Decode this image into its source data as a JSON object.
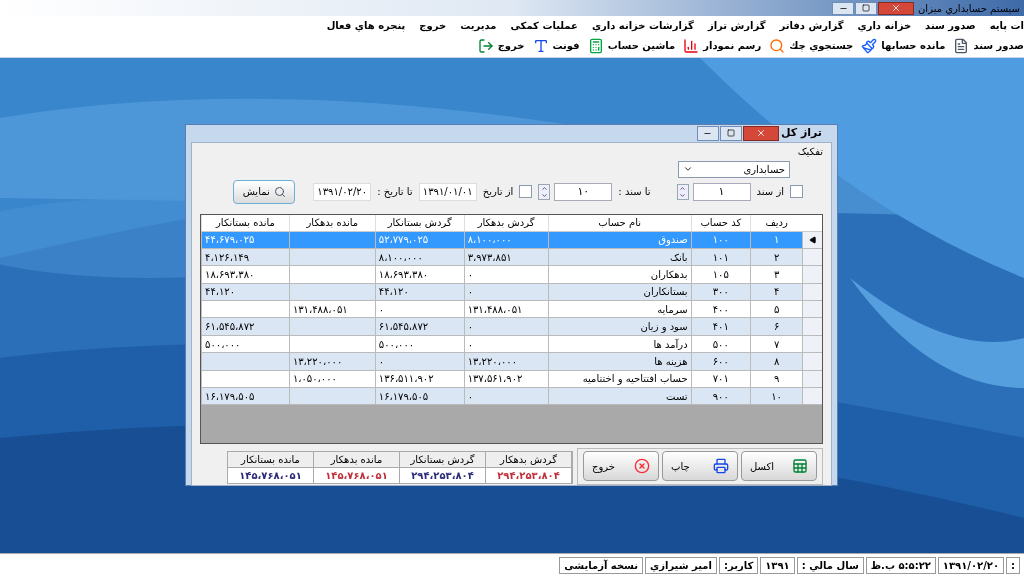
{
  "app_window": {
    "title": "سیستم حسابداري ميزان"
  },
  "menu": [
    "ات پایه",
    "صدور سند",
    "خزانه داري",
    "گزارش دفاتر",
    "گزارش تراز",
    "گزارشات خزانه داري",
    "عملیات کمکی",
    "مدیریت",
    "خروج",
    "پنجره هاي فعال"
  ],
  "toolbar": [
    {
      "label": "صدور سند",
      "kind": "document"
    },
    {
      "label": "مانده حسابها",
      "kind": "brush"
    },
    {
      "label": "جستجوي چك",
      "kind": "search"
    },
    {
      "label": "رسم نمودار",
      "kind": "chart"
    },
    {
      "label": "ماشین حساب",
      "kind": "calculator"
    },
    {
      "label": "فونت",
      "kind": "font"
    },
    {
      "label": "خروج",
      "kind": "exit"
    }
  ],
  "dialog": {
    "title": "تراز کل",
    "group_label": "تفکیک",
    "category": "حسابداری",
    "from_doc": {
      "label": "از سند",
      "checked": false,
      "value": "۱"
    },
    "to_doc": {
      "label": "تا سند :",
      "value": "۱۰"
    },
    "from_date": {
      "label": "از تاریخ",
      "checked": false,
      "value": "۱۳۹۱/۰۱/۰۱"
    },
    "to_date": {
      "label": "تا تاریخ :",
      "value": "۱۳۹۱/۰۲/۲۰"
    },
    "show_button": "نمایش",
    "table": {
      "columns": [
        "ردیف",
        "کد حساب",
        "نام حساب",
        "گردش بدهکار",
        "گردش بستانکار",
        "مانده بدهکار",
        "مانده بستانکار"
      ],
      "rows": [
        {
          "selected": true,
          "cells": [
            "۱",
            "۱۰۰",
            "صندوق",
            "۸،۱۰۰،۰۰۰",
            "۵۲،۷۷۹،۰۲۵",
            null,
            "۴۴،۶۷۹،۰۲۵"
          ]
        },
        {
          "selected": false,
          "cells": [
            "۲",
            "۱۰۱",
            "بانک",
            "۳،۹۷۳،۸۵۱",
            "۸،۱۰۰،۰۰۰",
            null,
            "۴،۱۲۶،۱۴۹"
          ]
        },
        {
          "selected": false,
          "cells": [
            "۳",
            "۱۰۵",
            "بدهکاران",
            "۰",
            "۱۸،۶۹۳،۳۸۰",
            null,
            "۱۸،۶۹۳،۳۸۰"
          ]
        },
        {
          "selected": false,
          "cells": [
            "۴",
            "۳۰۰",
            "بستانکاران",
            "۰",
            "۴۴،۱۲۰",
            null,
            "۴۴،۱۲۰"
          ]
        },
        {
          "selected": false,
          "cells": [
            "۵",
            "۴۰۰",
            "سرمایه",
            "۱۳۱،۴۸۸،۰۵۱",
            "۰",
            "۱۳۱،۴۸۸،۰۵۱",
            null
          ]
        },
        {
          "selected": false,
          "cells": [
            "۶",
            "۴۰۱",
            "سود و زیان",
            "۰",
            "۶۱،۵۴۵،۸۷۲",
            null,
            "۶۱،۵۴۵،۸۷۲"
          ]
        },
        {
          "selected": false,
          "cells": [
            "۷",
            "۵۰۰",
            "درآمد ها",
            "۰",
            "۵۰۰،۰۰۰",
            null,
            "۵۰۰،۰۰۰"
          ]
        },
        {
          "selected": false,
          "cells": [
            "۸",
            "۶۰۰",
            "هزینه ها",
            "۱۳،۲۲۰،۰۰۰",
            "۰",
            "۱۳،۲۲۰،۰۰۰",
            null
          ]
        },
        {
          "selected": false,
          "cells": [
            "۹",
            "۷۰۱",
            "حساب افتتاحیه و اختتامیه",
            "۱۳۷،۵۶۱،۹۰۲",
            "۱۳۶،۵۱۱،۹۰۲",
            "۱،۰۵۰،۰۰۰",
            null
          ]
        },
        {
          "selected": false,
          "cells": [
            "۱۰",
            "۹۰۰",
            "تست",
            "۰",
            "۱۶،۱۷۹،۵۰۵",
            null,
            "۱۶،۱۷۹،۵۰۵"
          ]
        }
      ]
    },
    "totals": [
      {
        "label": "گردش بدهکار",
        "value": "۲۹۴،۲۵۳،۸۰۴",
        "color": "#c0303a"
      },
      {
        "label": "گردش بستانکار",
        "value": "۲۹۴،۲۵۳،۸۰۴",
        "color": "#2a2a7a"
      },
      {
        "label": "مانده بدهکار",
        "value": "۱۴۵،۷۶۸،۰۵۱",
        "color": "#c0303a"
      },
      {
        "label": "مانده بستانکار",
        "value": "۱۴۵،۷۶۸،۰۵۱",
        "color": "#2a2a7a"
      }
    ],
    "buttons": [
      {
        "label": "اکسل",
        "kind": "excel"
      },
      {
        "label": "چاپ",
        "kind": "print"
      },
      {
        "label": "خروج",
        "kind": "exit"
      }
    ]
  },
  "status_bar": [
    ":",
    "۱۳۹۱/۰۲/۲۰",
    "۵:۵:۲۲ ب.ظ",
    "سال مالي :",
    "۱۳۹۱",
    "کاربر:",
    "امیر شیرازي",
    "نسخه آزمایشی"
  ]
}
